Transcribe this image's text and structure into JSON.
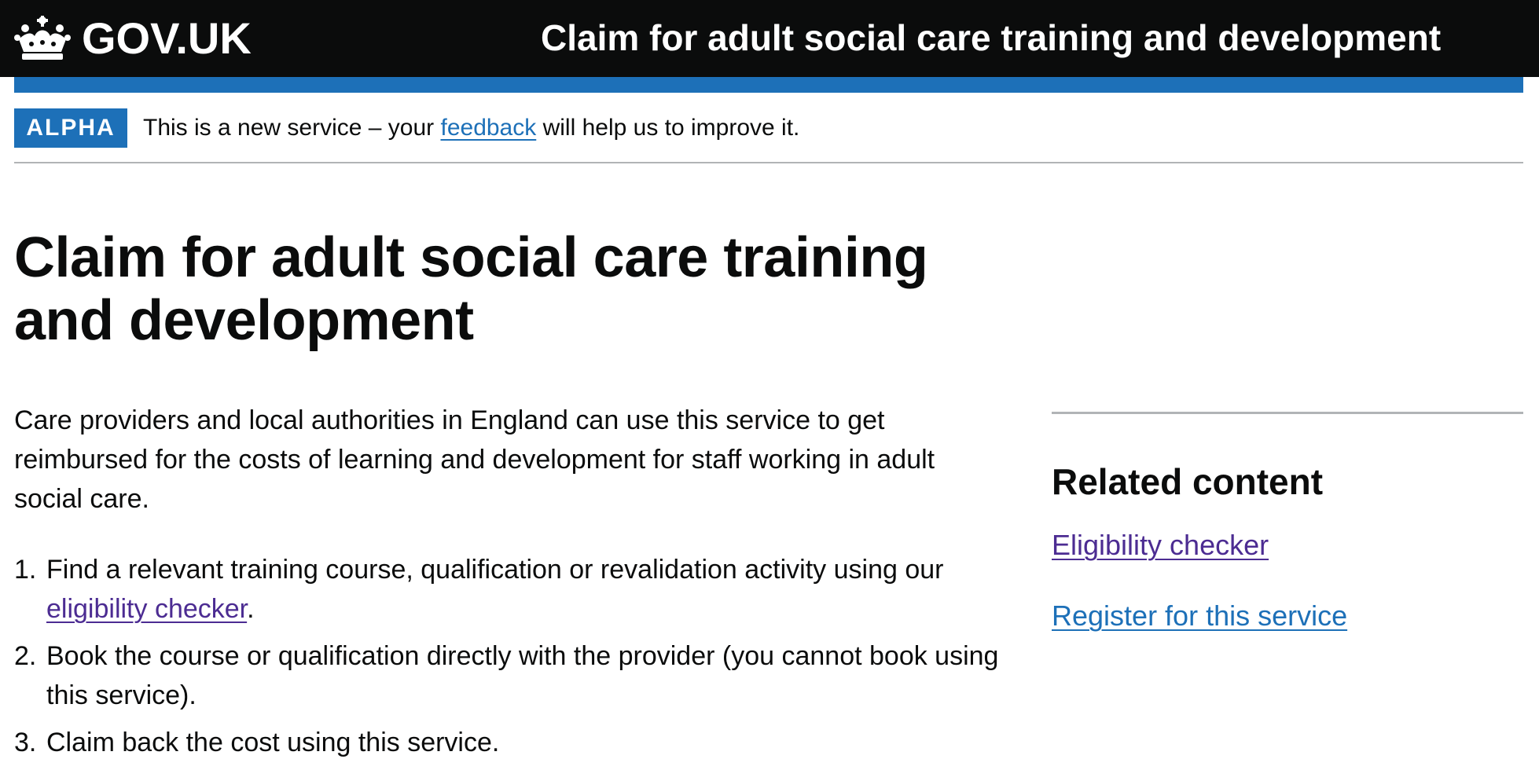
{
  "header": {
    "logo_text": "GOV.UK",
    "service_name": "Claim for adult social care training and development"
  },
  "phase_banner": {
    "tag": "ALPHA",
    "text_before": "This is a new service – your ",
    "link_text": "feedback",
    "text_after": " will help us to improve it."
  },
  "main": {
    "title": "Claim for adult social care training and development",
    "intro": "Care providers and local authorities in England can use this service to get reimbursed for the costs of learning and development for staff working in adult social care.",
    "steps": [
      {
        "text_before": "Find a relevant training course, qualification or revalidation activity using our ",
        "link_text": "eligibility checker",
        "text_after": "."
      },
      {
        "text": "Book the course or qualification directly with the provider (you cannot book using this service)."
      },
      {
        "text": "Claim back the cost using this service."
      }
    ]
  },
  "related": {
    "heading": "Related content",
    "links": [
      {
        "label": "Eligibility checker"
      },
      {
        "label": "Register for this service"
      }
    ]
  },
  "colors": {
    "header_bg": "#0b0c0c",
    "brand_blue": "#1d70b8",
    "link": "#1d70b8",
    "visited_link": "#4c2c92",
    "border_grey": "#b1b4b6",
    "text": "#0b0c0c"
  }
}
